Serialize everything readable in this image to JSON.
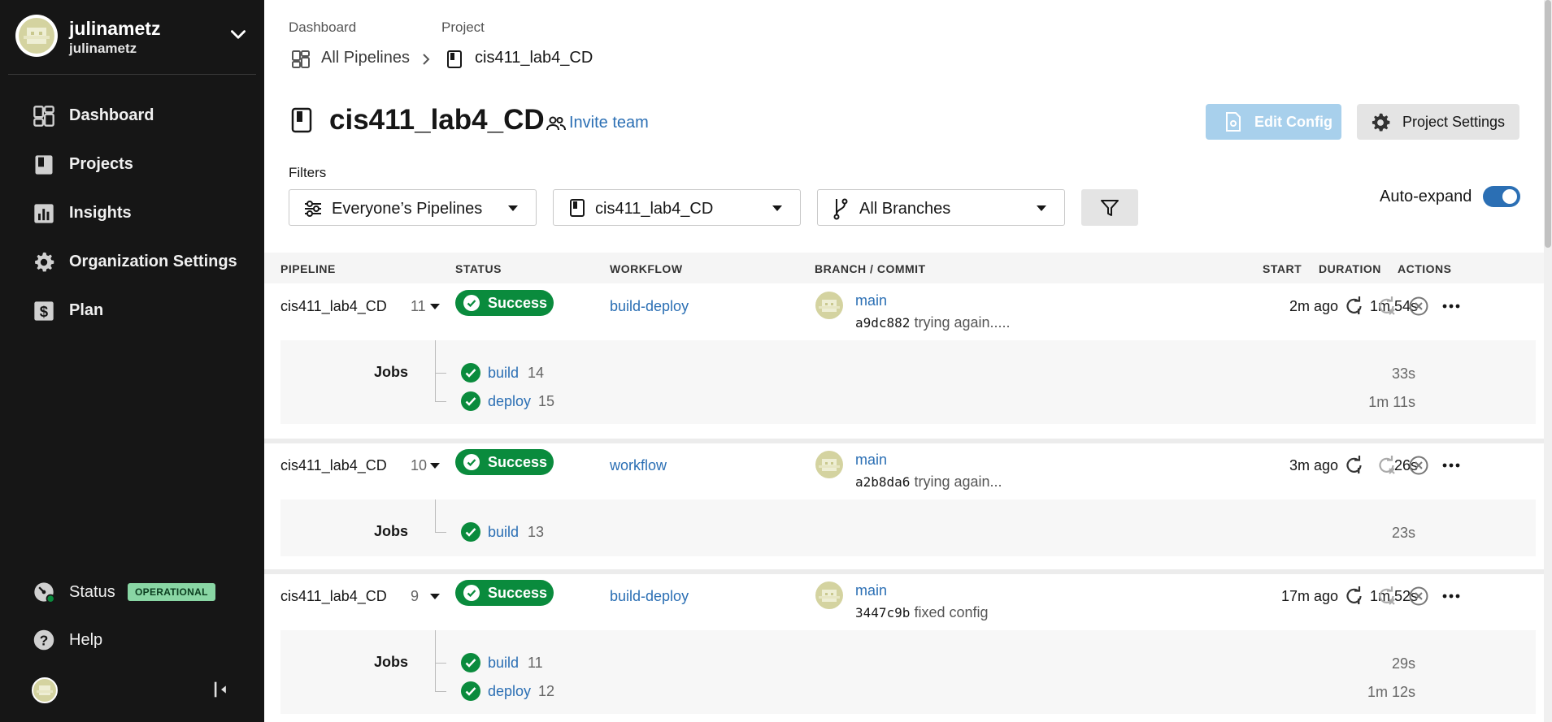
{
  "org": {
    "name": "julinametz",
    "sub": "julinametz"
  },
  "nav": [
    {
      "label": "Dashboard",
      "icon": "dashboard-icon"
    },
    {
      "label": "Projects",
      "icon": "projects-icon"
    },
    {
      "label": "Insights",
      "icon": "insights-icon"
    },
    {
      "label": "Organization Settings",
      "icon": "gear-icon"
    },
    {
      "label": "Plan",
      "icon": "plan-icon"
    }
  ],
  "status": {
    "label": "Status",
    "badge": "OPERATIONAL"
  },
  "help": {
    "label": "Help"
  },
  "breadcrumb": {
    "dashboard_label": "Dashboard",
    "project_label": "Project",
    "all_pipelines": "All Pipelines",
    "current": "cis411_lab4_CD"
  },
  "page": {
    "title": "cis411_lab4_CD",
    "invite": "Invite team",
    "edit_config": "Edit Config",
    "project_settings": "Project Settings"
  },
  "filters": {
    "label": "Filters",
    "pipelines": "Everyone’s Pipelines",
    "project": "cis411_lab4_CD",
    "branches": "All Branches",
    "auto_expand": "Auto-expand",
    "auto_expand_on": true
  },
  "table": {
    "headers": {
      "pipeline": "PIPELINE",
      "status": "STATUS",
      "workflow": "WORKFLOW",
      "branch": "BRANCH / COMMIT",
      "start": "START",
      "duration": "DURATION",
      "actions": "ACTIONS"
    },
    "jobs_label": "Jobs",
    "rows": [
      {
        "pipeline": "cis411_lab4_CD",
        "number": "11",
        "status": "Success",
        "workflow": "build-deploy",
        "branch": "main",
        "sha": "a9dc882",
        "message": "trying again.....",
        "start": "2m ago",
        "duration": "1m 54s",
        "jobs": [
          {
            "name": "build",
            "number": "14",
            "duration": "33s"
          },
          {
            "name": "deploy",
            "number": "15",
            "duration": "1m 11s"
          }
        ]
      },
      {
        "pipeline": "cis411_lab4_CD",
        "number": "10",
        "status": "Success",
        "workflow": "workflow",
        "branch": "main",
        "sha": "a2b8da6",
        "message": "trying again...",
        "start": "3m ago",
        "duration": "26s",
        "jobs": [
          {
            "name": "build",
            "number": "13",
            "duration": "23s"
          }
        ]
      },
      {
        "pipeline": "cis411_lab4_CD",
        "number": "9",
        "status": "Success",
        "workflow": "build-deploy",
        "branch": "main",
        "sha": "3447c9b",
        "message": "fixed config",
        "start": "17m ago",
        "duration": "1m 52s",
        "jobs": [
          {
            "name": "build",
            "number": "11",
            "duration": "29s"
          },
          {
            "name": "deploy",
            "number": "12",
            "duration": "1m 12s"
          }
        ]
      }
    ]
  },
  "colors": {
    "success": "#0a8b3d",
    "link": "#2b6fb4",
    "sidebar": "#161616",
    "badge": "#89d6a4"
  }
}
